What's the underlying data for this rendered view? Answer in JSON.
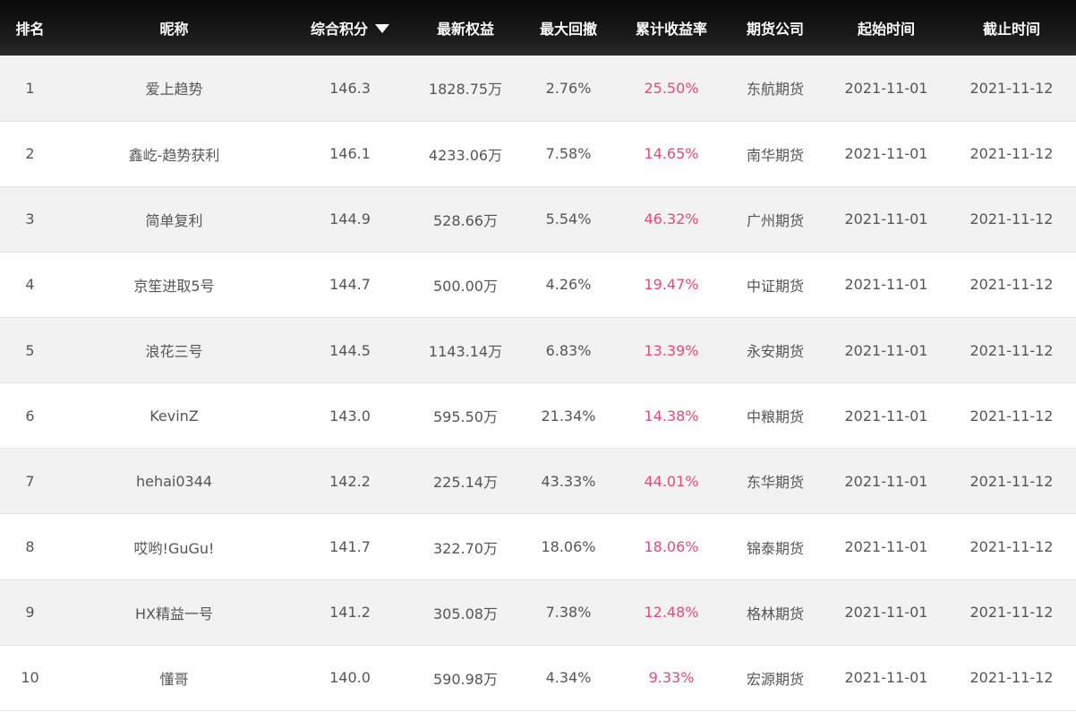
{
  "table": {
    "headers": {
      "rank": "排名",
      "nickname": "昵称",
      "score": "综合积分",
      "equity": "最新权益",
      "drawdown": "最大回撤",
      "return": "累计收益率",
      "company": "期货公司",
      "start": "起始时间",
      "end": "截止时间"
    },
    "sort": {
      "column": "score",
      "direction": "desc",
      "icon": "sort-desc-triangle-icon"
    },
    "colors": {
      "header_bg": "#141414",
      "header_text": "#ffffff",
      "row_alt": "#f2f2f2",
      "row": "#ffffff",
      "text": "#555555",
      "return_accent": "#e64a7a"
    },
    "rows": [
      {
        "rank": "1",
        "nickname": "爱上趋势",
        "score": "146.3",
        "equity": "1828.75万",
        "drawdown": "2.76%",
        "return": "25.50%",
        "company": "东航期货",
        "start": "2021-11-01",
        "end": "2021-11-12"
      },
      {
        "rank": "2",
        "nickname": "鑫屹-趋势获利",
        "score": "146.1",
        "equity": "4233.06万",
        "drawdown": "7.58%",
        "return": "14.65%",
        "company": "南华期货",
        "start": "2021-11-01",
        "end": "2021-11-12"
      },
      {
        "rank": "3",
        "nickname": "简单复利",
        "score": "144.9",
        "equity": "528.66万",
        "drawdown": "5.54%",
        "return": "46.32%",
        "company": "广州期货",
        "start": "2021-11-01",
        "end": "2021-11-12"
      },
      {
        "rank": "4",
        "nickname": "京笙进取5号",
        "score": "144.7",
        "equity": "500.00万",
        "drawdown": "4.26%",
        "return": "19.47%",
        "company": "中证期货",
        "start": "2021-11-01",
        "end": "2021-11-12"
      },
      {
        "rank": "5",
        "nickname": "浪花三号",
        "score": "144.5",
        "equity": "1143.14万",
        "drawdown": "6.83%",
        "return": "13.39%",
        "company": "永安期货",
        "start": "2021-11-01",
        "end": "2021-11-12"
      },
      {
        "rank": "6",
        "nickname": "KevinZ",
        "score": "143.0",
        "equity": "595.50万",
        "drawdown": "21.34%",
        "return": "14.38%",
        "company": "中粮期货",
        "start": "2021-11-01",
        "end": "2021-11-12"
      },
      {
        "rank": "7",
        "nickname": "hehai0344",
        "score": "142.2",
        "equity": "225.14万",
        "drawdown": "43.33%",
        "return": "44.01%",
        "company": "东华期货",
        "start": "2021-11-01",
        "end": "2021-11-12"
      },
      {
        "rank": "8",
        "nickname": "哎哟!GuGu!",
        "score": "141.7",
        "equity": "322.70万",
        "drawdown": "18.06%",
        "return": "18.06%",
        "company": "锦泰期货",
        "start": "2021-11-01",
        "end": "2021-11-12"
      },
      {
        "rank": "9",
        "nickname": "HX精益一号",
        "score": "141.2",
        "equity": "305.08万",
        "drawdown": "7.38%",
        "return": "12.48%",
        "company": "格林期货",
        "start": "2021-11-01",
        "end": "2021-11-12"
      },
      {
        "rank": "10",
        "nickname": "懂哥",
        "score": "140.0",
        "equity": "590.98万",
        "drawdown": "4.34%",
        "return": "9.33%",
        "company": "宏源期货",
        "start": "2021-11-01",
        "end": "2021-11-12"
      }
    ]
  }
}
